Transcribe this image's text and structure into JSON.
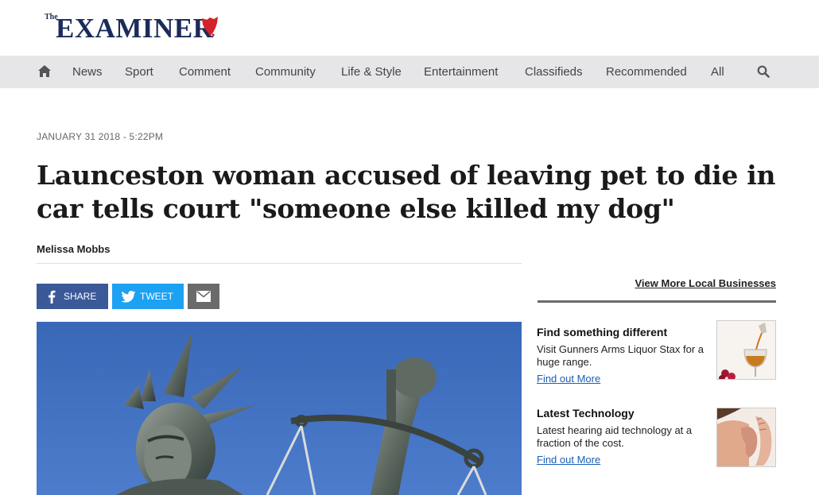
{
  "masthead": {
    "logo_the": "The",
    "logo_word": "EXAMINER"
  },
  "nav": {
    "home_icon": "home-icon",
    "search_icon": "search-icon",
    "items": [
      "News",
      "Sport",
      "Comment",
      "Community",
      "Life & Style",
      "Entertainment",
      "Classifieds",
      "Recommended",
      "All"
    ]
  },
  "article": {
    "dateline": "JANUARY 31 2018 - 5:22PM",
    "headline": "Launceston woman accused of leaving pet to die in car tells court \"someone else killed my dog\"",
    "byline": "Melissa Mobbs",
    "share": {
      "facebook": "SHARE",
      "twitter": "TWEET",
      "email_icon": "email-icon"
    }
  },
  "sidebar": {
    "view_more": "View More Local Businesses",
    "promos": [
      {
        "title": "Find something different",
        "text": "Visit Gunners Arms Liquor Stax for a huge range.",
        "link": "Find out More"
      },
      {
        "title": "Latest Technology",
        "text": "Latest hearing aid technology at a fraction of the cost.",
        "link": "Find out More"
      }
    ]
  },
  "colors": {
    "brand_navy": "#1b2c5a",
    "brand_red": "#d2232a",
    "facebook": "#3b5998",
    "twitter": "#1da1f2",
    "email": "#6b6b6b",
    "link": "#1a5fb4"
  }
}
